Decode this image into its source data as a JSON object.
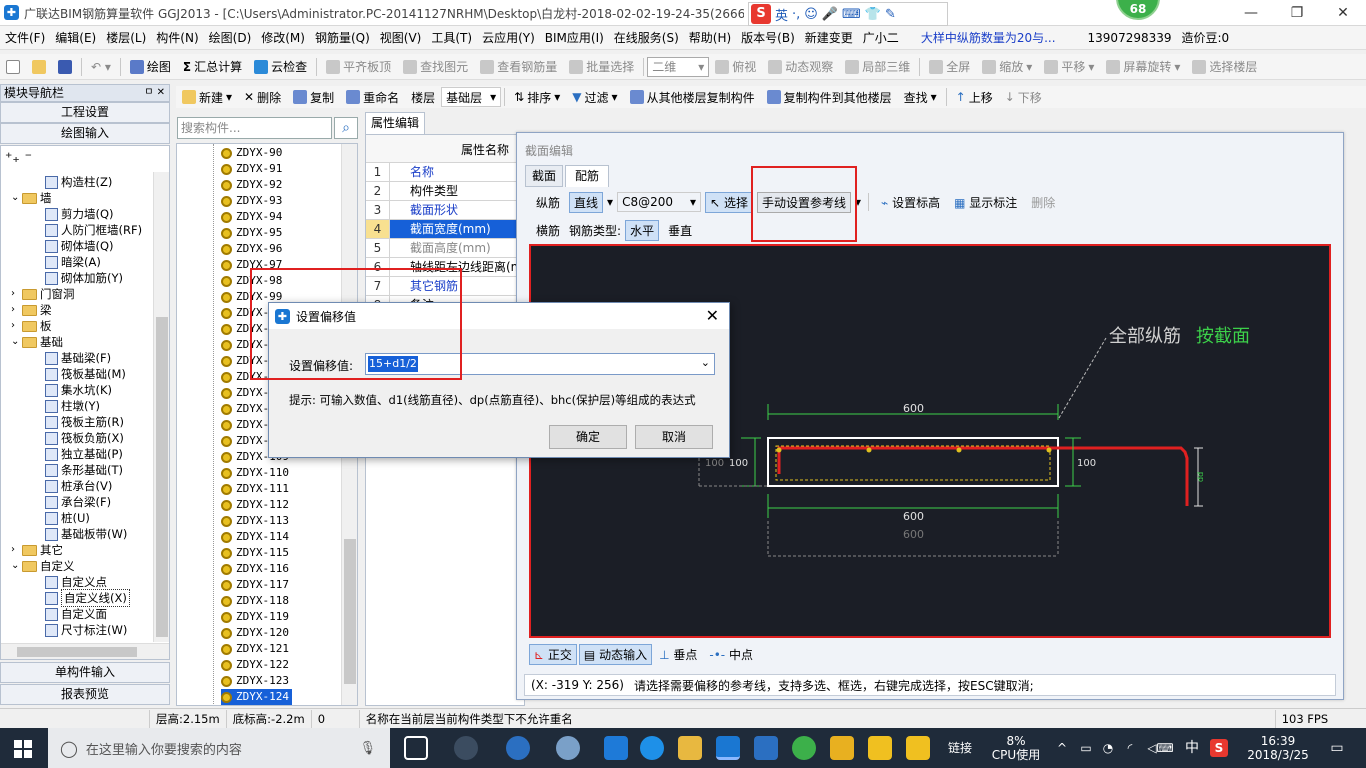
{
  "window": {
    "title": "广联达BIM钢筋算量软件 GGJ2013 - [C:\\Users\\Administrator.PC-20141127NRHM\\Desktop\\白龙村-2018-02-02-19-24-35(2666版",
    "controls": [
      "—",
      "❐",
      "✕"
    ]
  },
  "ime": {
    "logo": "S",
    "lang": "英",
    "items": [
      "·,",
      "☺",
      "🎤",
      "⌨",
      "👕",
      "✎"
    ]
  },
  "badge": "68",
  "menu": [
    "文件(F)",
    "编辑(E)",
    "楼层(L)",
    "构件(N)",
    "绘图(D)",
    "修改(M)",
    "钢筋量(Q)",
    "视图(V)",
    "工具(T)",
    "云应用(Y)",
    "BIM应用(I)",
    "在线服务(S)",
    "帮助(H)",
    "版本号(B)",
    "新建变更",
    "广小二"
  ],
  "menu_right": {
    "news": "大样中纵筋数量为20与...",
    "phone": "13907298339",
    "coins": "造价豆:0"
  },
  "toolbar1": {
    "items": [
      "绘图",
      "汇总计算",
      "云检查",
      "平齐板顶",
      "查找图元",
      "查看钢筋量",
      "批量选择",
      "俯视",
      "动态观察",
      "局部三维",
      "全屏",
      "缩放",
      "平移",
      "屏幕旋转",
      "选择楼层"
    ],
    "view_mode": "二维"
  },
  "toolbar2": {
    "items": [
      "新建",
      "删除",
      "复制",
      "重命名",
      "楼层",
      "排序",
      "过滤",
      "从其他楼层复制构件",
      "复制构件到其他楼层",
      "查找",
      "上移",
      "下移"
    ],
    "floor_value": "基础层"
  },
  "nav": {
    "title": "模块导航栏",
    "pin": "ㅁ ✕",
    "buttons_top": [
      "工程设置",
      "绘图输入"
    ],
    "buttons_bottom": [
      "单构件输入",
      "报表预览"
    ],
    "tree": [
      {
        "label": "构造柱(Z)",
        "level": 2,
        "type": "item"
      },
      {
        "label": "墙",
        "level": 1,
        "type": "folder-open"
      },
      {
        "label": "剪力墙(Q)",
        "level": 2,
        "type": "item"
      },
      {
        "label": "人防门框墙(RF)",
        "level": 2,
        "type": "item"
      },
      {
        "label": "砌体墙(Q)",
        "level": 2,
        "type": "item"
      },
      {
        "label": "暗梁(A)",
        "level": 2,
        "type": "item"
      },
      {
        "label": "砌体加筋(Y)",
        "level": 2,
        "type": "item"
      },
      {
        "label": "门窗洞",
        "level": 1,
        "type": "folder"
      },
      {
        "label": "梁",
        "level": 1,
        "type": "folder"
      },
      {
        "label": "板",
        "level": 1,
        "type": "folder"
      },
      {
        "label": "基础",
        "level": 1,
        "type": "folder-open"
      },
      {
        "label": "基础梁(F)",
        "level": 2,
        "type": "item"
      },
      {
        "label": "筏板基础(M)",
        "level": 2,
        "type": "item"
      },
      {
        "label": "集水坑(K)",
        "level": 2,
        "type": "item"
      },
      {
        "label": "柱墩(Y)",
        "level": 2,
        "type": "item"
      },
      {
        "label": "筏板主筋(R)",
        "level": 2,
        "type": "item"
      },
      {
        "label": "筏板负筋(X)",
        "level": 2,
        "type": "item"
      },
      {
        "label": "独立基础(P)",
        "level": 2,
        "type": "item"
      },
      {
        "label": "条形基础(T)",
        "level": 2,
        "type": "item"
      },
      {
        "label": "桩承台(V)",
        "level": 2,
        "type": "item"
      },
      {
        "label": "承台梁(F)",
        "level": 2,
        "type": "item"
      },
      {
        "label": "桩(U)",
        "level": 2,
        "type": "item"
      },
      {
        "label": "基础板带(W)",
        "level": 2,
        "type": "item"
      },
      {
        "label": "其它",
        "level": 1,
        "type": "folder"
      },
      {
        "label": "自定义",
        "level": 1,
        "type": "folder-open"
      },
      {
        "label": "自定义点",
        "level": 2,
        "type": "item"
      },
      {
        "label": "自定义线(X)",
        "level": 2,
        "type": "item-selected"
      },
      {
        "label": "自定义面",
        "level": 2,
        "type": "item"
      },
      {
        "label": "尺寸标注(W)",
        "level": 2,
        "type": "item"
      }
    ]
  },
  "components": {
    "search_placeholder": "搜索构件...",
    "items": [
      "ZDYX-90",
      "ZDYX-91",
      "ZDYX-92",
      "ZDYX-93",
      "ZDYX-94",
      "ZDYX-95",
      "ZDYX-96",
      "ZDYX-97",
      "ZDYX-98",
      "ZDYX-99",
      "ZDYX-100",
      "ZDYX-101",
      "ZDYX-102",
      "ZDYX-103",
      "ZDYX-104",
      "ZDYX-105",
      "ZDYX-106",
      "ZDYX-107",
      "ZDYX-108",
      "ZDYX-109",
      "ZDYX-110",
      "ZDYX-111",
      "ZDYX-112",
      "ZDYX-113",
      "ZDYX-114",
      "ZDYX-115",
      "ZDYX-116",
      "ZDYX-117",
      "ZDYX-118",
      "ZDYX-119",
      "ZDYX-120",
      "ZDYX-121",
      "ZDYX-122",
      "ZDYX-123",
      "ZDYX-124"
    ],
    "selected": "ZDYX-124"
  },
  "props": {
    "tab": "属性编辑",
    "header": "属性名称",
    "rows": [
      {
        "n": "1",
        "label": "名称",
        "style": "blue"
      },
      {
        "n": "2",
        "label": "构件类型",
        "style": "normal"
      },
      {
        "n": "3",
        "label": "截面形状",
        "style": "blue"
      },
      {
        "n": "4",
        "label": "截面宽度(mm)",
        "style": "selected"
      },
      {
        "n": "5",
        "label": "截面高度(mm)",
        "style": "gray"
      },
      {
        "n": "6",
        "label": "轴线距左边线距离(m",
        "style": "normal"
      },
      {
        "n": "7",
        "label": "其它钢筋",
        "style": "blue"
      },
      {
        "n": "8",
        "label": "备注",
        "style": "normal"
      }
    ]
  },
  "section_editor": {
    "title": "截面编辑",
    "tabs": [
      "截面",
      "配筋"
    ],
    "active_tab": "配筋",
    "row1": {
      "longbar": "纵筋",
      "line": "直线",
      "spec": "C8@200",
      "select": "选择",
      "manual_ref": "手动设置参考线",
      "set_elev": "设置标高",
      "show_label": "显示标注",
      "delete": "删除"
    },
    "row2": {
      "stirrup": "横筋",
      "type_label": "钢筋类型:",
      "horizontal": "水平",
      "vertical": "垂直"
    },
    "canvas": {
      "caption_a": "全部纵筋",
      "caption_b": "按截面",
      "dims": {
        "top": "600",
        "bottom": "600",
        "bottom_ghost": "600",
        "left_inner": "100",
        "left_outer": "100",
        "right": "100",
        "right_bar": "dd"
      }
    },
    "bottom_tools": [
      "正交",
      "动态输入",
      "垂点",
      "中点"
    ],
    "status": {
      "coords": "(X: -319 Y: 256)",
      "message": "请选择需要偏移的参考线，支持多选、框选，右键完成选择，按ESC键取消;"
    }
  },
  "dialog": {
    "title": "设置偏移值",
    "label": "设置偏移值:",
    "value": "15+d1/2",
    "hint": "提示: 可输入数值、d1(线筋直径)、dp(点筋直径)、bhc(保护层)等组成的表达式",
    "ok": "确定",
    "cancel": "取消"
  },
  "statusbar": {
    "floor_h": "层高:2.15m",
    "base_h": "底标高:-2.2m",
    "zero": "0",
    "message": "名称在当前层当前构件类型下不允许重名",
    "fps": "103 FPS"
  },
  "taskbar": {
    "search_placeholder": "在这里输入你要搜索的内容",
    "tray_link": "链接",
    "cpu_pct": "8%",
    "cpu_label": "CPU使用",
    "lang": "中",
    "time": "16:39",
    "date": "2018/3/25"
  },
  "colors": {
    "accent": "#1660d8",
    "annotation": "#e02020",
    "canvas_bg": "#1b1e26",
    "rebar": "#e02020",
    "dim": "#3cd04a"
  }
}
